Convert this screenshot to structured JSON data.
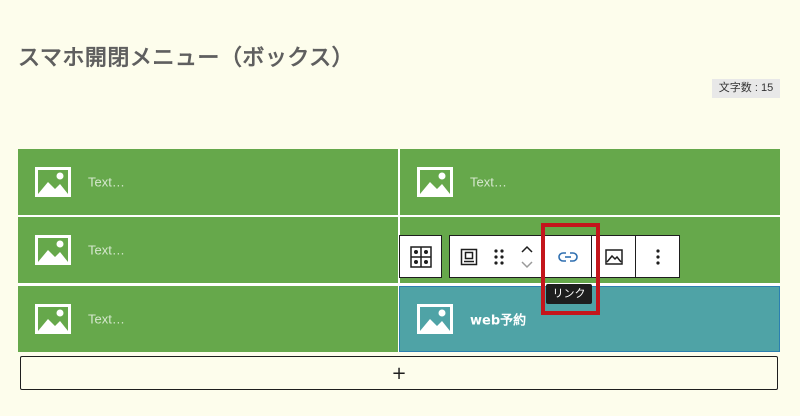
{
  "page": {
    "title": "スマホ開閉メニュー（ボックス）",
    "char_count": "文字数 : 15"
  },
  "grid": {
    "cells": [
      {
        "text": "Text…",
        "icon": "image-icon"
      },
      {
        "text": "Text…",
        "icon": "image-icon"
      },
      {
        "text": "Text…",
        "icon": "image-icon"
      },
      {
        "text": "",
        "icon": "image-icon"
      },
      {
        "text": "Text…",
        "icon": "image-icon"
      },
      {
        "text": "web予約",
        "icon": "image-icon",
        "selected": true
      }
    ],
    "add_label": "+"
  },
  "toolbar": {
    "items": [
      {
        "name": "block-type",
        "icon": "grid-block-icon"
      },
      {
        "name": "parent-select",
        "icon": "parent-block-icon"
      },
      {
        "name": "drag",
        "icon": "drag-handle-icon"
      },
      {
        "name": "move",
        "icon": "move-up-down-icon"
      },
      {
        "name": "link",
        "icon": "link-icon"
      },
      {
        "name": "media",
        "icon": "image-replace-icon"
      },
      {
        "name": "options",
        "icon": "more-vertical-icon"
      }
    ],
    "tooltip": "リンク"
  },
  "colors": {
    "background": "#fdfdec",
    "cell_green": "#66a84b",
    "cell_selected": "#4fa3a6",
    "highlight": "#c4161c"
  }
}
